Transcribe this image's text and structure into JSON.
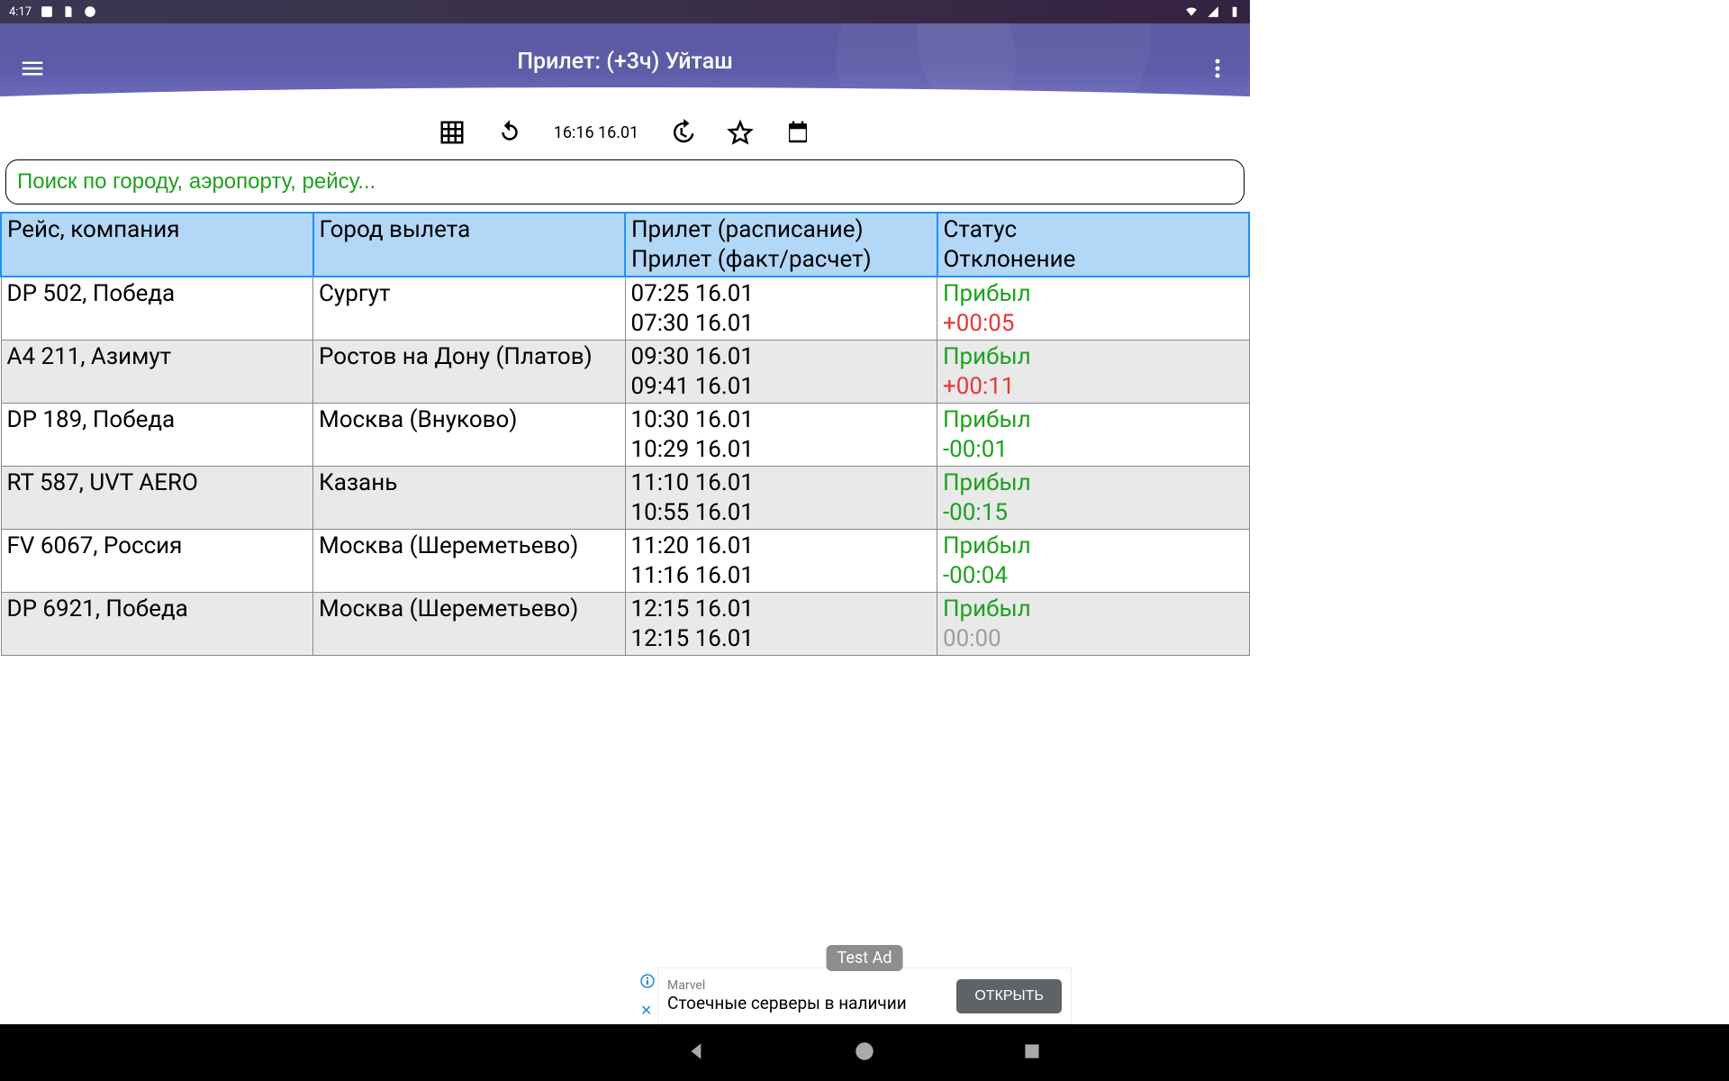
{
  "statusbar": {
    "time": "4:17"
  },
  "appbar": {
    "title": "Прилет: (+3ч) Уйташ"
  },
  "toolbar": {
    "datetime": "16:16 16.01"
  },
  "search": {
    "placeholder": "Поиск по городу, аэропорту, рейсу..."
  },
  "headers": {
    "flight": "Рейс, компания",
    "origin": "Город вылета",
    "time1": "Прилет (расписание)",
    "time2": "Прилет (факт/расчет)",
    "status": "Статус",
    "deviation": "Отклонение"
  },
  "rows": [
    {
      "flight": "DP 502, Победа",
      "origin": "Сургут",
      "sched": "07:25 16.01",
      "actual": "07:30 16.01",
      "status": "Прибыл",
      "dev": "+00:05",
      "devClass": "dev-red"
    },
    {
      "flight": "A4 211, Азимут",
      "origin": "Ростов на Дону (Платов)",
      "sched": "09:30 16.01",
      "actual": "09:41 16.01",
      "status": "Прибыл",
      "dev": "+00:11",
      "devClass": "dev-red"
    },
    {
      "flight": "DP 189, Победа",
      "origin": "Москва (Внуково)",
      "sched": "10:30 16.01",
      "actual": "10:29 16.01",
      "status": "Прибыл",
      "dev": "-00:01",
      "devClass": "dev-green"
    },
    {
      "flight": "RT 587, UVT AERO",
      "origin": "Казань",
      "sched": "11:10 16.01",
      "actual": "10:55 16.01",
      "status": "Прибыл",
      "dev": "-00:15",
      "devClass": "dev-green"
    },
    {
      "flight": "FV 6067, Россия",
      "origin": "Москва (Шереметьево)",
      "sched": "11:20 16.01",
      "actual": "11:16 16.01",
      "status": "Прибыл",
      "dev": "-00:04",
      "devClass": "dev-green"
    },
    {
      "flight": "DP 6921, Победа",
      "origin": "Москва (Шереметьево)",
      "sched": "12:15 16.01",
      "actual": "12:15 16.01",
      "status": "Прибыл",
      "dev": "00:00",
      "devClass": "dev-grey"
    }
  ],
  "ad": {
    "label": "Test Ad",
    "title": "Marvel",
    "subtitle": "Стоечные серверы в наличии",
    "button": "ОТКРЫТЬ"
  }
}
